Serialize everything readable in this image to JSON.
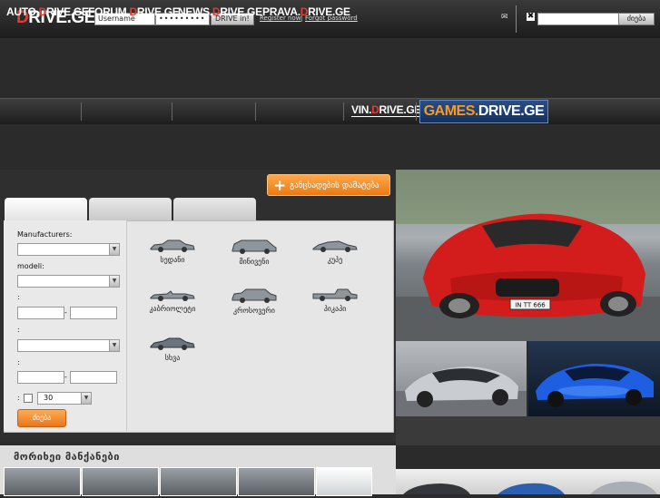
{
  "header": {
    "logo_prefix": "D",
    "logo_rest": "RIVE.GE",
    "username_placeholder": "Username",
    "password_mask": "•••••••••",
    "login_button": "DRIVE in!",
    "register_link": "Register now",
    "link_separator": "|",
    "forgot_link": "Forgot password",
    "search_button": "ძიება"
  },
  "nav": {
    "items": [
      {
        "pre": "AUTO.",
        "d": "D",
        "post": "RIVE.GE"
      },
      {
        "pre": "FORUM.",
        "d": "D",
        "post": "RIVE.GE"
      },
      {
        "pre": "NEWS.",
        "d": "D",
        "post": "RIVE.GE"
      },
      {
        "pre": "PRAVA.",
        "d": "D",
        "post": "RIVE.GE"
      },
      {
        "pre": "VIN.",
        "d": "D",
        "post": "RIVE.GE"
      }
    ],
    "games": {
      "pre": "GAMES.",
      "post": "DRIVE.GE"
    }
  },
  "add_listing_button": "განცხადების დამატება",
  "search_form": {
    "manufacturers_label": "Manufacturers:",
    "model_label": "modeli:",
    "colon": ":",
    "dash": "-",
    "count_value": "30",
    "search_button": "ძიება"
  },
  "body_types": [
    {
      "label": "სედანი",
      "icon": "sedan-icon"
    },
    {
      "label": "მინივენი",
      "icon": "minivan-icon"
    },
    {
      "label": "კუპე",
      "icon": "coupe-icon"
    },
    {
      "label": "კაბრიოლეტი",
      "icon": "cabriolet-icon"
    },
    {
      "label": "კროსოვერი",
      "icon": "crossover-icon"
    },
    {
      "label": "პიკაპი",
      "icon": "pickup-icon"
    },
    {
      "label": "სხვა",
      "icon": "other-car-icon"
    }
  ],
  "photo_main_plate": "IN TT 666",
  "more_cars_title": "მორიხეი მანქანები",
  "colors": {
    "accent": "#e63b2e",
    "orange": "#f08a24",
    "games_blue": "#1c3d73"
  }
}
